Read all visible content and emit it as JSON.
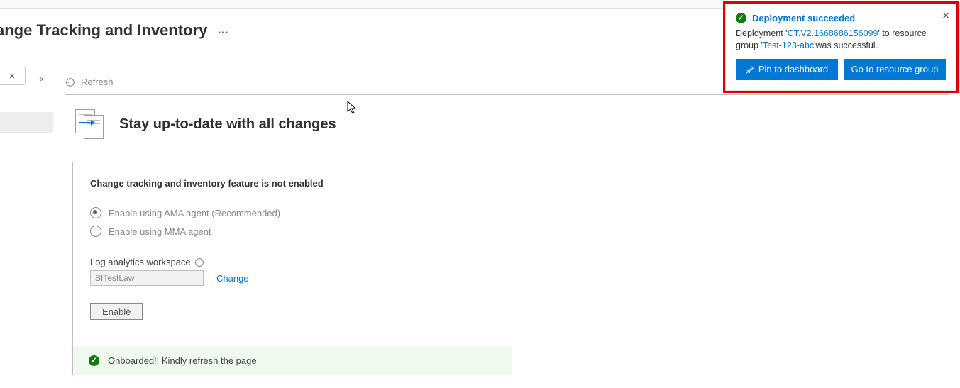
{
  "page": {
    "title": "ange Tracking and Inventory",
    "ellipsis": "…"
  },
  "toolbar": {
    "refresh_label": "Refresh"
  },
  "hero": {
    "title": "Stay up-to-date with all changes"
  },
  "card": {
    "heading": "Change tracking and inventory feature is not enabled",
    "radio_options": [
      {
        "label": "Enable using AMA agent (Recommended)",
        "checked": true
      },
      {
        "label": "Enable using MMA agent",
        "checked": false
      }
    ],
    "workspace_label": "Log analytics workspace",
    "workspace_value": "SITestLaw",
    "change_link": "Change",
    "enable_button": "Enable",
    "status_message": "Onboarded!! Kindly refresh the page"
  },
  "toast": {
    "title": "Deployment succeeded",
    "body_prefix": "Deployment '",
    "deployment_name": "CT.V2.1668686156099",
    "body_mid": "' to resource group '",
    "resource_group": "Test-123-abc",
    "body_suffix": "'was successful.",
    "pin_button": "Pin to dashboard",
    "goto_button": "Go to resource group"
  }
}
